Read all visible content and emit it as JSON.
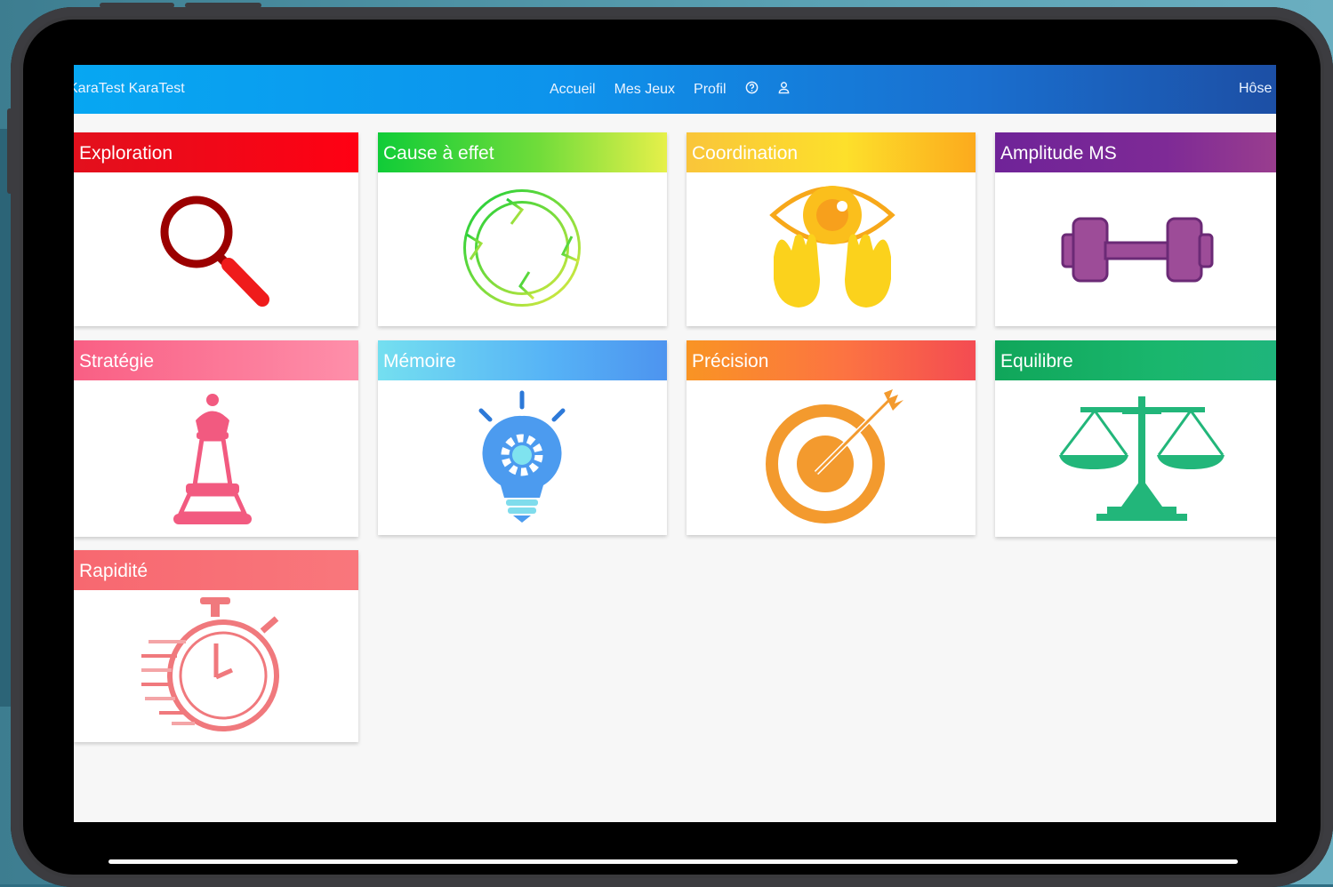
{
  "navbar": {
    "brand": "KaraTest KaraTest",
    "menu": [
      "Accueil",
      "Mes Jeux",
      "Profil"
    ],
    "help_icon": "help-circle-icon",
    "user_icon": "user-icon",
    "right_text": "Hôse"
  },
  "cards": [
    {
      "label": "Exploration",
      "icon": "magnifying-glass-icon",
      "color": "#e8001a"
    },
    {
      "label": "Cause à effet",
      "icon": "cycle-arrows-icon",
      "color": "#2ccf3a"
    },
    {
      "label": "Coordination",
      "icon": "eye-hands-icon",
      "color": "#f8c21c"
    },
    {
      "label": "Amplitude MS",
      "icon": "dumbbell-icon",
      "color": "#7a2a98"
    },
    {
      "label": "Stratégie",
      "icon": "chess-pawn-icon",
      "color": "#f7648a"
    },
    {
      "label": "Mémoire",
      "icon": "lightbulb-gear-icon",
      "color": "#55b8f5"
    },
    {
      "label": "Précision",
      "icon": "target-arrow-icon",
      "color": "#f76a3c"
    },
    {
      "label": "Equilibre",
      "icon": "balance-scale-icon",
      "color": "#12a865"
    },
    {
      "label": "Rapidité",
      "icon": "stopwatch-icon",
      "color": "#f46b72"
    }
  ]
}
